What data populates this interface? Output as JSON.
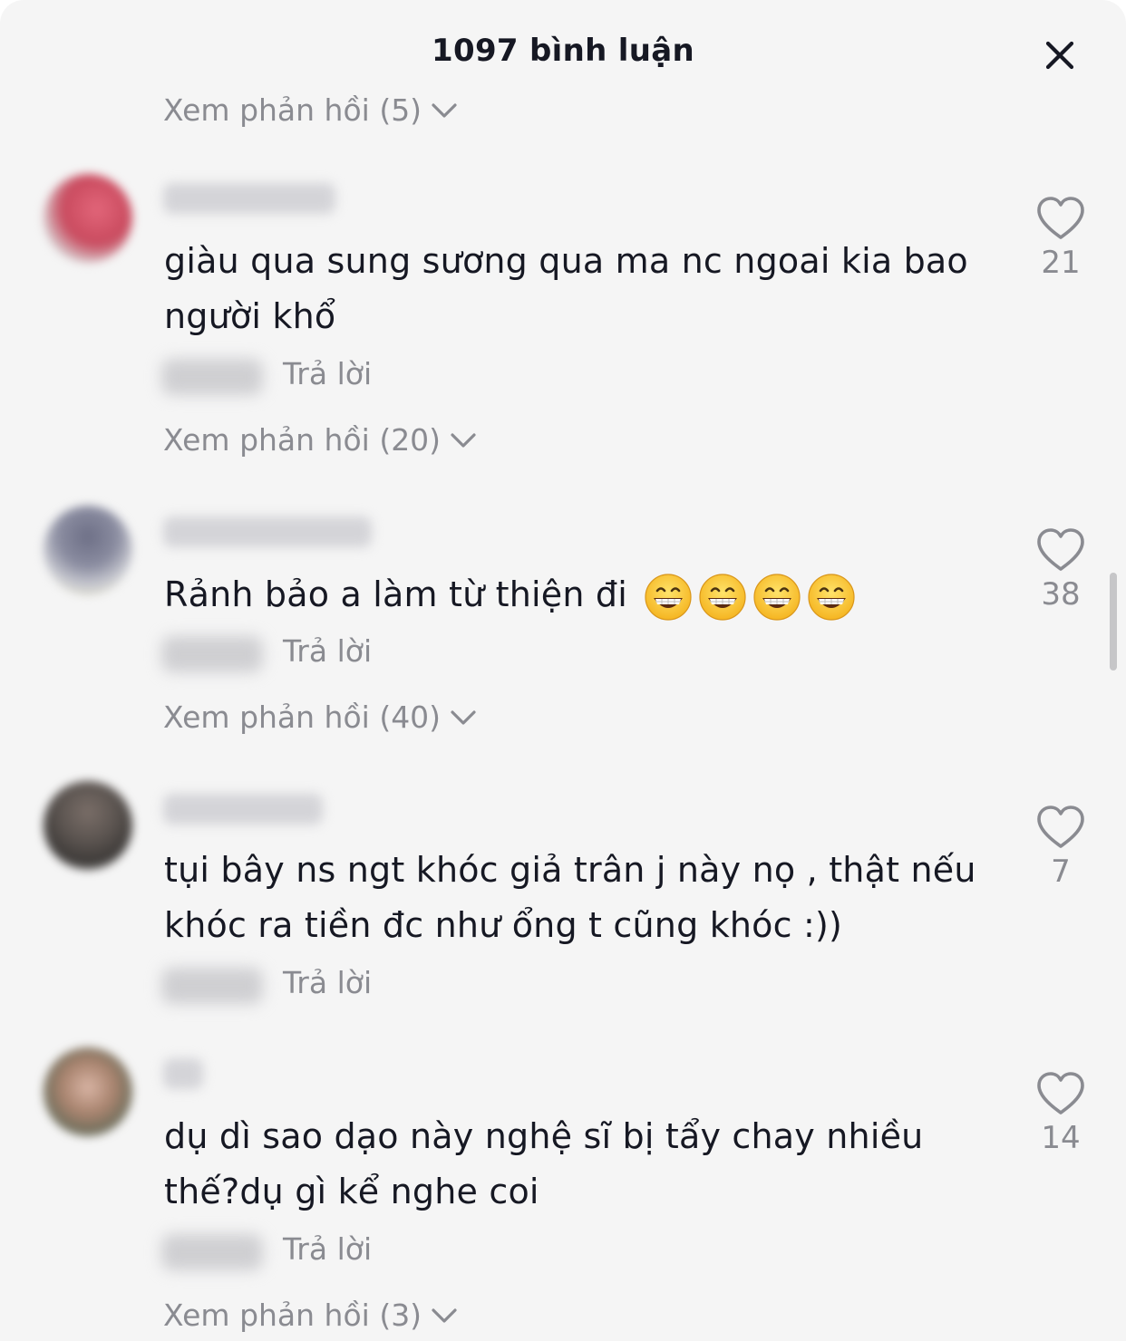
{
  "header": {
    "title": "1097 bình luận"
  },
  "top_partial": {
    "view_replies_label": "Xem phản hồi (5)"
  },
  "comments": [
    {
      "text": "giàu qua sung sương qua ma nc ngoai kia bao người khổ",
      "reply_label": "Trả lời",
      "likes": "21",
      "view_replies_label": "Xem phản hồi (20)"
    },
    {
      "text": "Rảnh bảo a làm từ thiện đi",
      "emoji_count": 4,
      "reply_label": "Trả lời",
      "likes": "38",
      "view_replies_label": "Xem phản hồi (40)"
    },
    {
      "text": "tụi bây ns ngt khóc giả trân j này nọ , thật nếu khóc ra tiền đc như ổng t cũng khóc :))",
      "reply_label": "Trả lời",
      "likes": "7"
    },
    {
      "text": "dụ dì sao dạo này nghệ sĩ bị tẩy chay nhiều thế?dụ gì kể nghe coi",
      "reply_label": "Trả lời",
      "likes": "14",
      "view_replies_label": "Xem phản hồi (3)"
    }
  ],
  "colors": {
    "background": "#f5f5f5",
    "text_primary": "#161823",
    "text_secondary": "#8a8b91"
  }
}
